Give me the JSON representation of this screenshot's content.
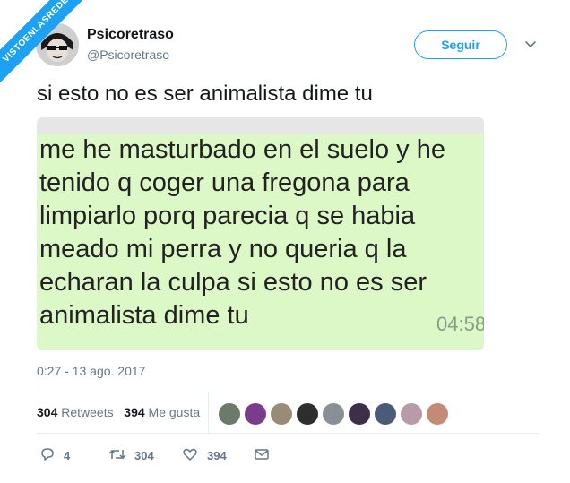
{
  "watermark": "VISTOENLASREDES",
  "author": {
    "name": "Psicoretraso",
    "handle": "@Psicoretraso"
  },
  "follow_label": "Seguir",
  "tweet_text": "si esto no es ser animalista dime tu",
  "chat_message": {
    "text": "me he masturbado en el suelo y he\ntenido q coger una fregona para\nlimpiarlo porq parecia q se habia\nmeado mi perra y no queria q la\necharan la culpa si esto no es ser\nanimalista dime tu",
    "time": "04:58"
  },
  "timestamp": "0:27 - 13 ago. 2017",
  "stats": {
    "retweets_count": "304",
    "retweets_label": "Retweets",
    "likes_count": "394",
    "likes_label": "Me gusta"
  },
  "actions": {
    "reply_count": "4",
    "retweet_count": "304",
    "like_count": "394"
  },
  "liker_colors": [
    "#6b7a6a",
    "#7a3d8c",
    "#9a8a78",
    "#2e2e2e",
    "#8a8f96",
    "#3c2f4a",
    "#4b5a78",
    "#b89aa8",
    "#c48a78"
  ],
  "colors": {
    "accent": "#1da1f2",
    "muted": "#657786",
    "bubble": "#dcf8c6"
  }
}
